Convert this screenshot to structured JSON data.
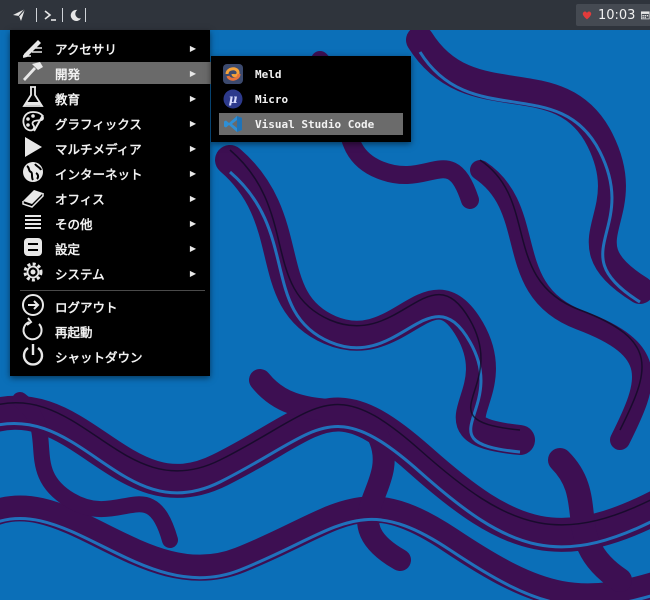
{
  "panel": {
    "launcher_icon": "paper-plane-icon",
    "terminal_icon": "terminal-icon",
    "moon_icon": "night-mode-icon",
    "tray": {
      "heart_icon": "heart-icon",
      "clock": "10:03",
      "calendar_icon": "calendar-icon"
    }
  },
  "main_menu": {
    "items": [
      {
        "label": "アクセサリ",
        "icon": "accessories-pen-icon",
        "has_submenu": true
      },
      {
        "label": "開発",
        "icon": "hammer-icon",
        "has_submenu": true,
        "active": true
      },
      {
        "label": "教育",
        "icon": "flask-icon",
        "has_submenu": true
      },
      {
        "label": "グラフィックス",
        "icon": "palette-icon",
        "has_submenu": true
      },
      {
        "label": "マルチメディア",
        "icon": "play-icon",
        "has_submenu": true
      },
      {
        "label": "インターネット",
        "icon": "globe-icon",
        "has_submenu": true
      },
      {
        "label": "オフィス",
        "icon": "book-icon",
        "has_submenu": true
      },
      {
        "label": "その他",
        "icon": "list-icon",
        "has_submenu": true
      },
      {
        "label": "設定",
        "icon": "settings-icon",
        "has_submenu": true
      },
      {
        "label": "システム",
        "icon": "gear-icon",
        "has_submenu": true
      }
    ],
    "actions": [
      {
        "label": "ログアウト",
        "icon": "logout-icon"
      },
      {
        "label": "再起動",
        "icon": "restart-icon"
      },
      {
        "label": "シャットダウン",
        "icon": "power-icon"
      }
    ],
    "arrow": "▶"
  },
  "sub_menu": {
    "items": [
      {
        "label": "Meld",
        "icon": "meld-icon"
      },
      {
        "label": "Micro",
        "icon": "micro-icon"
      },
      {
        "label": "Visual Studio Code",
        "icon": "vscode-icon",
        "active": true
      }
    ]
  },
  "colors": {
    "panel_bg": "#2f343c",
    "menu_bg": "#000000",
    "highlight": "#6a6a6a",
    "wallpaper_blue": "#0b6fb8",
    "wallpaper_purple": "#3d0f52"
  }
}
